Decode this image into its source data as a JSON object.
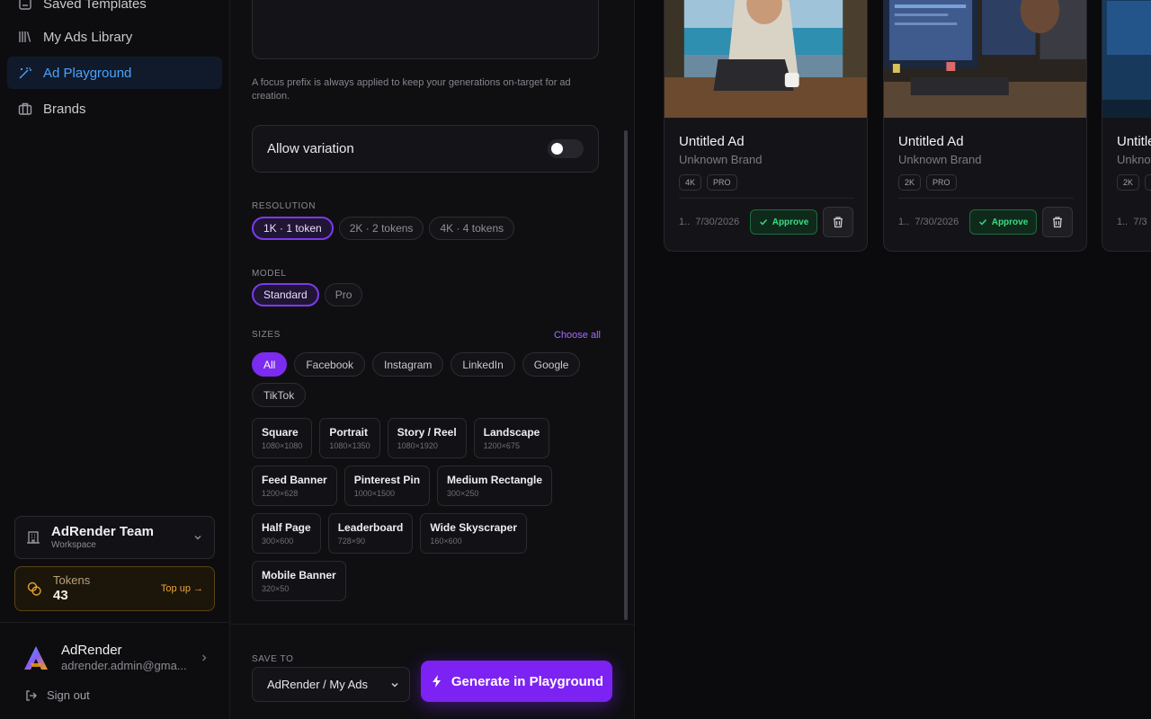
{
  "sidebar": {
    "items": [
      {
        "label": "Saved Templates"
      },
      {
        "label": "My Ads Library"
      },
      {
        "label": "Ad Playground",
        "active": true
      },
      {
        "label": "Brands"
      }
    ],
    "workspace": {
      "name": "AdRender Team",
      "sub": "Workspace"
    },
    "tokens": {
      "label": "Tokens",
      "value": "43",
      "topup": "Top up →"
    },
    "user": {
      "name": "AdRender",
      "email": "adrender.admin@gma..."
    },
    "signout": "Sign out"
  },
  "panel": {
    "hint": "A focus prefix is always applied to keep your generations on-target for ad creation.",
    "variation_label": "Allow variation",
    "variation_on": false,
    "resolution": {
      "label": "RESOLUTION",
      "options": [
        "1K · 1 token",
        "2K · 2 tokens",
        "4K · 4 tokens"
      ],
      "selected": "1K · 1 token"
    },
    "model": {
      "label": "MODEL",
      "options": [
        "Standard",
        "Pro"
      ],
      "selected": "Standard"
    },
    "sizes": {
      "label": "SIZES",
      "choose_all": "Choose all",
      "filters": [
        "All",
        "Facebook",
        "Instagram",
        "LinkedIn",
        "Google",
        "TikTok"
      ],
      "selected_filter": "All",
      "items": [
        {
          "name": "Square",
          "dim": "1080×1080"
        },
        {
          "name": "Portrait",
          "dim": "1080×1350"
        },
        {
          "name": "Story / Reel",
          "dim": "1080×1920"
        },
        {
          "name": "Landscape",
          "dim": "1200×675"
        },
        {
          "name": "Feed Banner",
          "dim": "1200×628"
        },
        {
          "name": "Pinterest Pin",
          "dim": "1000×1500"
        },
        {
          "name": "Medium Rectangle",
          "dim": "300×250"
        },
        {
          "name": "Half Page",
          "dim": "300×600"
        },
        {
          "name": "Leaderboard",
          "dim": "728×90"
        },
        {
          "name": "Wide Skyscraper",
          "dim": "160×600"
        },
        {
          "name": "Mobile Banner",
          "dim": "320×50"
        }
      ]
    },
    "save_to": {
      "label": "SAVE TO",
      "value": "AdRender / My Ads"
    },
    "generate": "Generate in Playground"
  },
  "gallery": {
    "cards": [
      {
        "title": "Untitled Ad",
        "brand": "Unknown Brand",
        "tags": [
          "4K",
          "PRO"
        ],
        "date_prefix": "1..",
        "date": "7/30/2026",
        "approve": "Approve"
      },
      {
        "title": "Untitled Ad",
        "brand": "Unknown Brand",
        "tags": [
          "2K",
          "PRO"
        ],
        "date_prefix": "1..",
        "date": "7/30/2026",
        "approve": "Approve"
      },
      {
        "title": "Untitled",
        "brand": "Unknow",
        "tags": [
          "2K",
          ""
        ],
        "date_prefix": "1..",
        "date": "7/3",
        "approve": ""
      }
    ]
  }
}
